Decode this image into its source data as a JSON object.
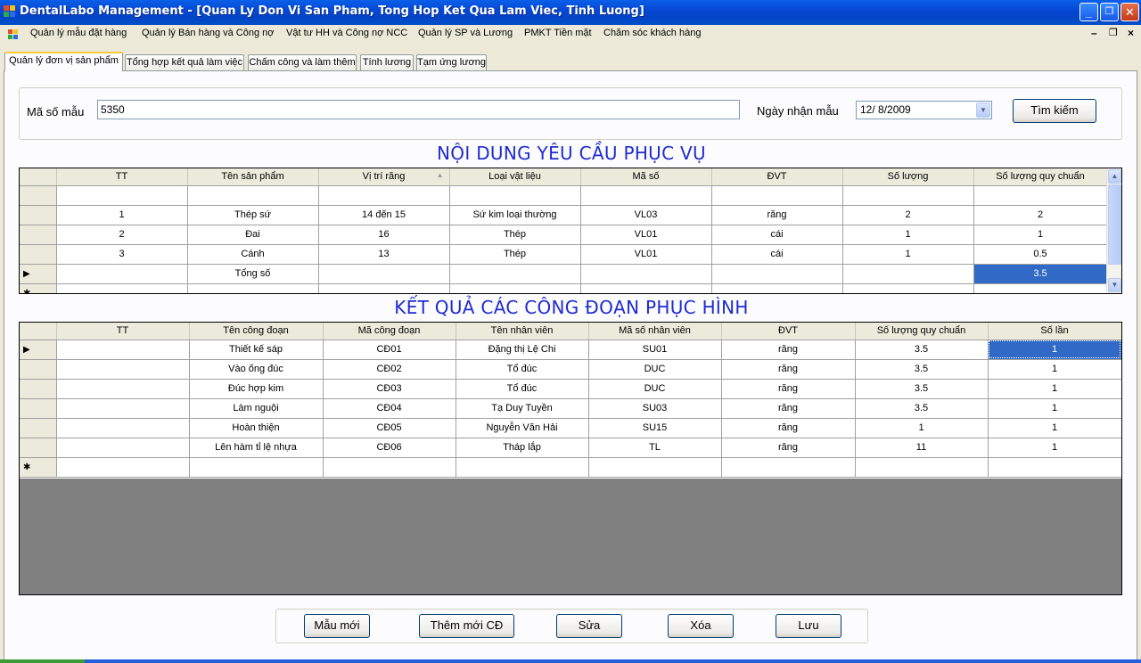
{
  "window": {
    "title": "DentalLabo Management - [Quan Ly Don Vi San Pham, Tong Hop Ket Qua Lam Viec, Tinh Luong]",
    "minimize": "_",
    "maximize": "❐",
    "close": "✕"
  },
  "menu": {
    "items": [
      "Quản lý mẫu đặt hàng",
      "Quản lý Bán hàng và Công nợ",
      "Vật tư HH và Công nợ NCC",
      "Quản lý SP và Lương",
      "PMKT Tiền mặt",
      "Chăm sóc khách hàng"
    ],
    "mdi_min": "–",
    "mdi_restore": "❐",
    "mdi_close": "×"
  },
  "tabs": [
    "Quản lý đơn vị sản phẩm",
    "Tổng hợp kết quả làm việc",
    "Chấm công và làm thêm",
    "Tính lương",
    "Tạm ứng lương"
  ],
  "search": {
    "sample_label": "Mã số mẫu",
    "sample_value": "5350",
    "date_label": "Ngày nhận mẫu",
    "date_value": "12/  8/2009",
    "search_button": "Tìm kiếm"
  },
  "section1": {
    "heading": "NỘI DUNG YÊU CẦU PHỤC VỤ",
    "columns": [
      "TT",
      "Tên sản phẩm",
      "Vị trí răng",
      "Loại vật liệu",
      "Mã số",
      "ĐVT",
      "Số lượng",
      "Số lượng quy chuẩn"
    ],
    "sort_indicator": "▲",
    "rows": [
      [
        "",
        "",
        "",
        "",
        "",
        "",
        "",
        ""
      ],
      [
        "1",
        "Thép sứ",
        "14 đến 15",
        "Sứ kim loại thường",
        "VL03",
        "răng",
        "2",
        "2"
      ],
      [
        "2",
        "Đai",
        "16",
        "Thép",
        "VL01",
        "cái",
        "1",
        "1"
      ],
      [
        "3",
        "Cánh",
        "13",
        "Thép",
        "VL01",
        "cái",
        "1",
        "0.5"
      ],
      [
        "",
        "Tổng số",
        "",
        "",
        "",
        "",
        "",
        "3.5"
      ]
    ],
    "current_marker": "▶",
    "new_marker": "✱"
  },
  "section2": {
    "heading": "KẾT QUẢ CÁC CÔNG ĐOẠN PHỤC HÌNH",
    "columns": [
      "TT",
      "Tên công đoạn",
      "Mã công đoạn",
      "Tên nhân viên",
      "Mã số nhân viên",
      "ĐVT",
      "Số lượng quy chuẩn",
      "Số lần"
    ],
    "rows": [
      [
        "",
        "Thiết kế sáp",
        "CĐ01",
        "Đặng thị Lệ Chi",
        "SU01",
        "răng",
        "3.5",
        "1"
      ],
      [
        "",
        "Vào ống đúc",
        "CĐ02",
        "Tổ đúc",
        "DUC",
        "răng",
        "3.5",
        "1"
      ],
      [
        "",
        "Đúc hợp kim",
        "CĐ03",
        "Tổ đúc",
        "DUC",
        "răng",
        "3.5",
        "1"
      ],
      [
        "",
        "Làm nguội",
        "CĐ04",
        "Tạ Duy Tuyền",
        "SU03",
        "răng",
        "3.5",
        "1"
      ],
      [
        "",
        "Hoàn thiện",
        "CĐ05",
        "Nguyễn Văn Hải",
        "SU15",
        "răng",
        "1",
        "1"
      ],
      [
        "",
        "Lên hàm tỉ lệ nhựa",
        "CĐ06",
        "Tháp lắp",
        "TL",
        "răng",
        "11",
        "1"
      ],
      [
        "",
        "",
        "",
        "",
        "",
        "",
        "",
        ""
      ]
    ],
    "current_marker": "▶",
    "new_marker": "✱"
  },
  "actions": {
    "new_sample": "Mẫu mới",
    "add_step": "Thêm mới CĐ",
    "edit": "Sửa",
    "delete": "Xóa",
    "save": "Lưu"
  },
  "colors": {
    "title_blue": "#0548d6",
    "heading_blue": "#1f2bd1",
    "selection": "#3169c6",
    "grid_empty": "#808080"
  }
}
